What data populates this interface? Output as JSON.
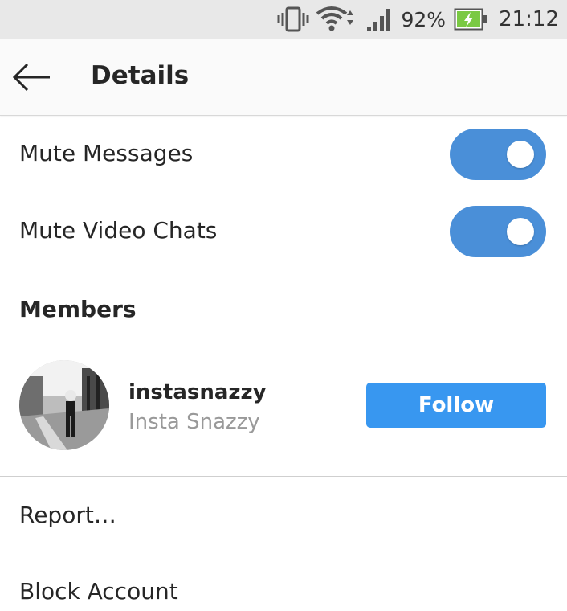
{
  "status_bar": {
    "battery_percent": "92%",
    "time": "21:12",
    "icons": [
      "vibrate-icon",
      "wifi-icon",
      "signal-icon",
      "battery-charging-icon"
    ],
    "battery_color": "#7ac943"
  },
  "header": {
    "title": "Details",
    "back_icon": "arrow-left-icon"
  },
  "settings": [
    {
      "label": "Mute Messages",
      "enabled": true
    },
    {
      "label": "Mute Video Chats",
      "enabled": true
    }
  ],
  "members": {
    "title": "Members",
    "items": [
      {
        "username": "instasnazzy",
        "full_name": "Insta Snazzy",
        "action_label": "Follow"
      }
    ]
  },
  "actions": [
    "Report…",
    "Block Account"
  ],
  "colors": {
    "toggle_on": "#4a8fd8",
    "follow_button": "#3897f0",
    "secondary_text": "#999999"
  }
}
